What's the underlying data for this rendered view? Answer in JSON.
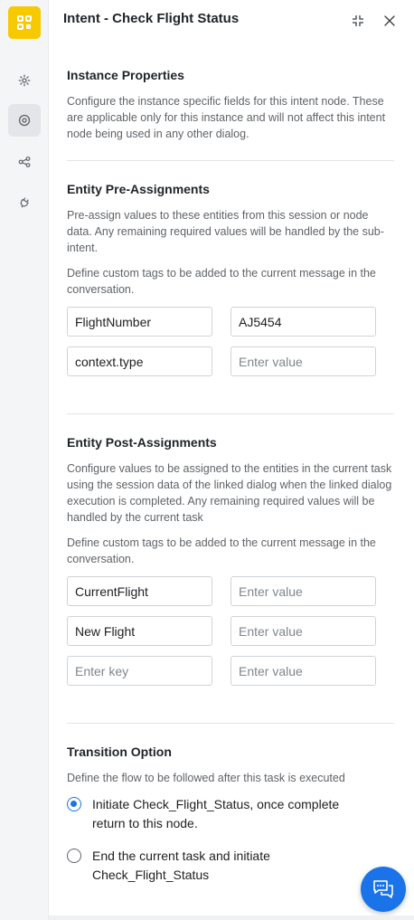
{
  "header": {
    "title": "Intent - Check Flight Status"
  },
  "sidebar": {
    "items": [
      {
        "icon": "gear-icon"
      },
      {
        "icon": "target-icon"
      },
      {
        "icon": "share-icon"
      },
      {
        "icon": "plug-icon"
      }
    ]
  },
  "instance_properties": {
    "title": "Instance Properties",
    "description": "Configure the instance specific fields for this intent node. These are applicable only for this instance and will not affect this intent node being used in any other dialog."
  },
  "pre_assignments": {
    "title": "Entity Pre-Assignments",
    "description": "Pre-assign values to these entities from this session or node data. Any remaining required values will be handled by the sub-intent.",
    "tags_description": "Define custom tags to be added to the current message in the conversation.",
    "rows": [
      {
        "key": "FlightNumber",
        "value": "AJ5454"
      },
      {
        "key": "context.type",
        "value": "",
        "value_placeholder": "Enter value"
      }
    ]
  },
  "post_assignments": {
    "title": "Entity Post-Assignments",
    "description": "Configure values to be assigned to the entities in the current task using the session data of the linked dialog when the linked dialog execution is completed. Any remaining required values will be handled by the current task",
    "tags_description": "Define custom tags to be added to the current message in the conversation.",
    "rows": [
      {
        "key": "CurrentFlight",
        "value": "",
        "value_placeholder": "Enter value"
      },
      {
        "key": "New Flight",
        "value": "",
        "value_placeholder": "Enter value"
      },
      {
        "key": "",
        "key_placeholder": "Enter key",
        "value": "",
        "value_placeholder": "Enter value"
      }
    ]
  },
  "transition": {
    "title": "Transition Option",
    "description": "Define the flow to be followed after this task is executed",
    "options": [
      {
        "label": "Initiate Check_Flight_Status, once complete return to this node.",
        "selected": true
      },
      {
        "label": "End the current task and initiate Check_Flight_Status",
        "selected": false
      }
    ]
  },
  "colors": {
    "accent": "#1a73e8",
    "logo": "#f7c900"
  }
}
